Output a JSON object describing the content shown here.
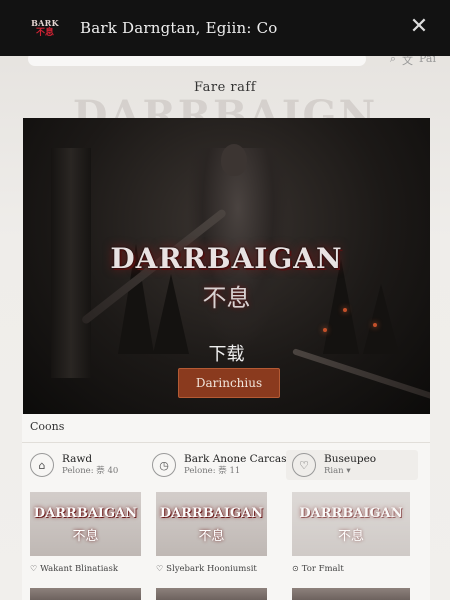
{
  "window": {
    "logo_line1": "BARK",
    "logo_line2": "不息",
    "title": "Bark Darngtan, Egiin: Co",
    "close_icon": "close-icon"
  },
  "background": {
    "watermark": "DARRBAIGN",
    "icon_search": "⌕",
    "icon_lang": "文",
    "icon_lang_label": "Pai"
  },
  "page": {
    "subtitle": "Fare raff"
  },
  "hero": {
    "logo_text": "DARRBAIGAN",
    "logo_sub": "不息",
    "cn_label": "下载",
    "button_label": "Darinchius"
  },
  "sheet": {
    "title": "Coons",
    "cards": [
      {
        "icon": "gift-icon",
        "glyph": "⌂",
        "title": "Rawd",
        "sub": "Pelone: 萘 40"
      },
      {
        "icon": "clock-icon",
        "glyph": "◷",
        "title": "Bark Anone Carcas",
        "sub": "Pelone: 萘 11"
      },
      {
        "icon": "heart-icon",
        "glyph": "♡",
        "title": "Buseupeo",
        "sub": "Rian ▾"
      }
    ],
    "thumbs": [
      {
        "title": "DARRBAIGAN",
        "sub": "不息",
        "caption_icon": "♡",
        "caption": "Wakant Blinatiask"
      },
      {
        "title": "DARRBAIGAN",
        "sub": "不息",
        "caption_icon": "♡",
        "caption": "Slyebark Hooniumsit"
      },
      {
        "title": "DARRBAIGAN",
        "sub": "不息",
        "caption_icon": "⊙",
        "caption": "Tor Fmalt"
      }
    ]
  }
}
